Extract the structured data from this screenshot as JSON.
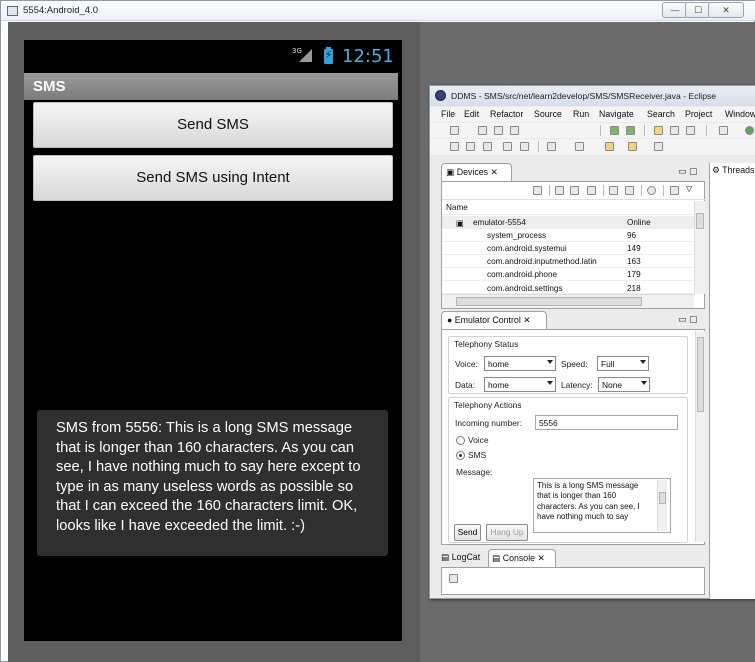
{
  "window": {
    "title": "5554:Android_4.0",
    "min_label": "—",
    "max_label": "☐",
    "close_label": "✕"
  },
  "phone": {
    "status": {
      "network": "3G",
      "time": "12:51"
    },
    "app_title": "SMS",
    "buttons": {
      "send_sms": "Send SMS",
      "send_intent": "Send SMS using Intent"
    },
    "toast": "SMS from 5556: This is a long SMS message that is longer than 160 characters. As you can see, I have nothing much to say here except to type in as many useless words as possible so that I can exceed the 160 characters limit. OK, looks like I have exceeded the limit. :-)"
  },
  "eclipse": {
    "title": "DDMS - SMS/src/net/learn2develop/SMS/SMSReceiver.java - Eclipse",
    "menu": [
      "File",
      "Edit",
      "Refactor",
      "Source",
      "Run",
      "Navigate",
      "Search",
      "Project",
      "Window"
    ],
    "devices": {
      "tab": "Devices",
      "column_name": "Name",
      "rows": [
        {
          "name": "emulator-5554",
          "value": "Online"
        },
        {
          "name": "system_process",
          "value": "96"
        },
        {
          "name": "com.android.systemui",
          "value": "149"
        },
        {
          "name": "com.android.inputmethod.latin",
          "value": "163"
        },
        {
          "name": "com.android.phone",
          "value": "179"
        },
        {
          "name": "com.android.settings",
          "value": "218"
        }
      ]
    },
    "emulator_control": {
      "tab": "Emulator Control",
      "telephony_status": "Telephony Status",
      "voice_label": "Voice:",
      "voice_value": "home",
      "speed_label": "Speed:",
      "speed_value": "Full",
      "data_label": "Data:",
      "data_value": "home",
      "latency_label": "Latency:",
      "latency_value": "None",
      "telephony_actions": "Telephony Actions",
      "incoming_label": "Incoming number:",
      "incoming_value": "5556",
      "radio_voice": "Voice",
      "radio_sms": "SMS",
      "message_label": "Message:",
      "message_value": "This is a long SMS message that is longer than 160 characters. As you can see, I have nothing much to say",
      "send_button": "Send",
      "hangup_button": "Hang Up"
    },
    "bottom_tabs": {
      "logcat": "LogCat",
      "console": "Console"
    },
    "right_tab": "Threads"
  },
  "colors": {
    "clock": "#33b5e5",
    "toast_bg": "#2f2f2f",
    "phone_bg": "#000000"
  }
}
